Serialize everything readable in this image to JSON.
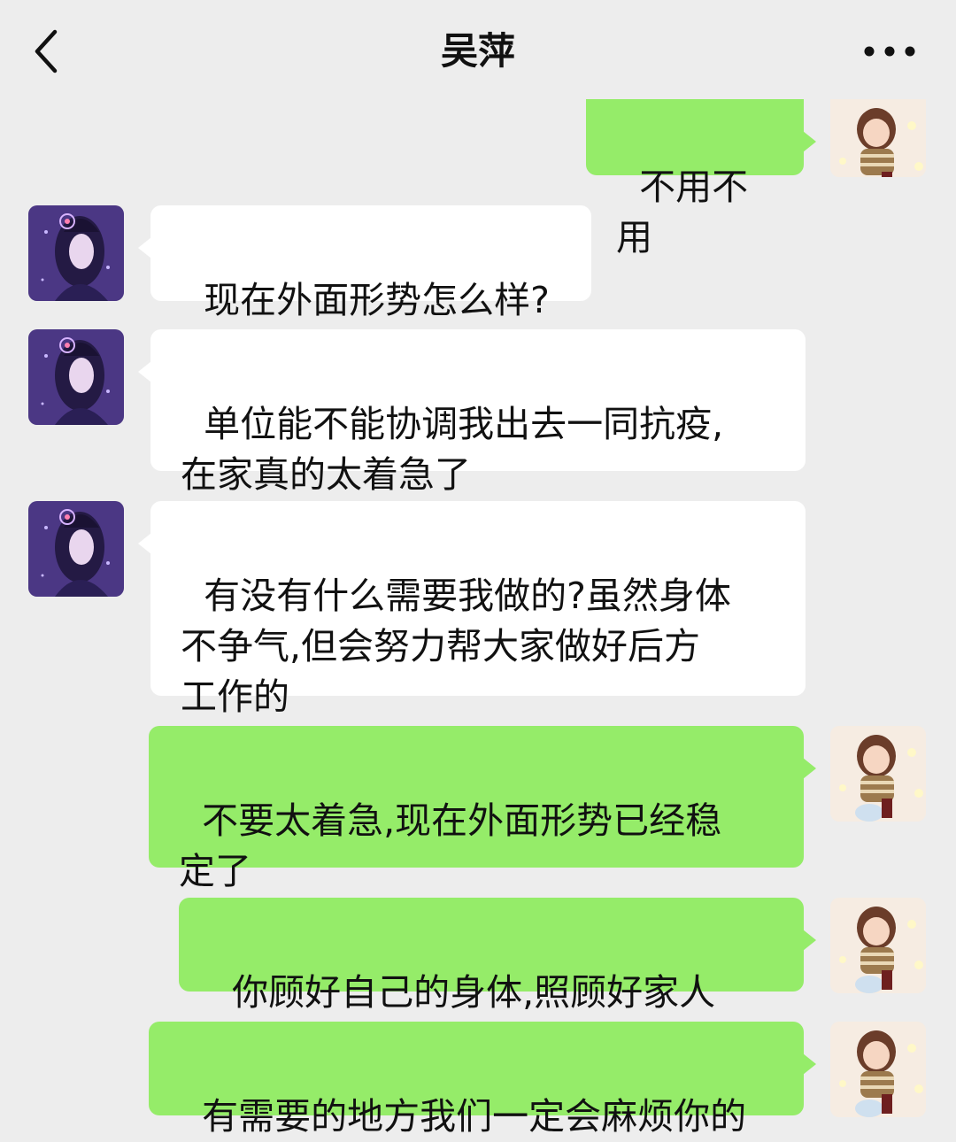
{
  "header": {
    "title": "吴萍",
    "back_icon": "chevron-left-icon",
    "more_icon": "more-dots-icon"
  },
  "colors": {
    "background": "#ededed",
    "incoming_bubble": "#ffffff",
    "outgoing_bubble": "#95ec69"
  },
  "messages": [
    {
      "direction": "outgoing",
      "text": "不用不用"
    },
    {
      "direction": "incoming",
      "text": "现在外面形势怎么样?"
    },
    {
      "direction": "incoming",
      "text": "单位能不能协调我出去一同抗疫,\n在家真的太着急了"
    },
    {
      "direction": "incoming",
      "text": "有没有什么需要我做的?虽然身体\n不争气,但会努力帮大家做好后方\n工作的"
    },
    {
      "direction": "outgoing",
      "text": "不要太着急,现在外面形势已经稳\n定了"
    },
    {
      "direction": "outgoing",
      "text": "你顾好自己的身体,照顾好家人"
    },
    {
      "direction": "outgoing",
      "text": "有需要的地方我们一定会麻烦你的"
    }
  ]
}
